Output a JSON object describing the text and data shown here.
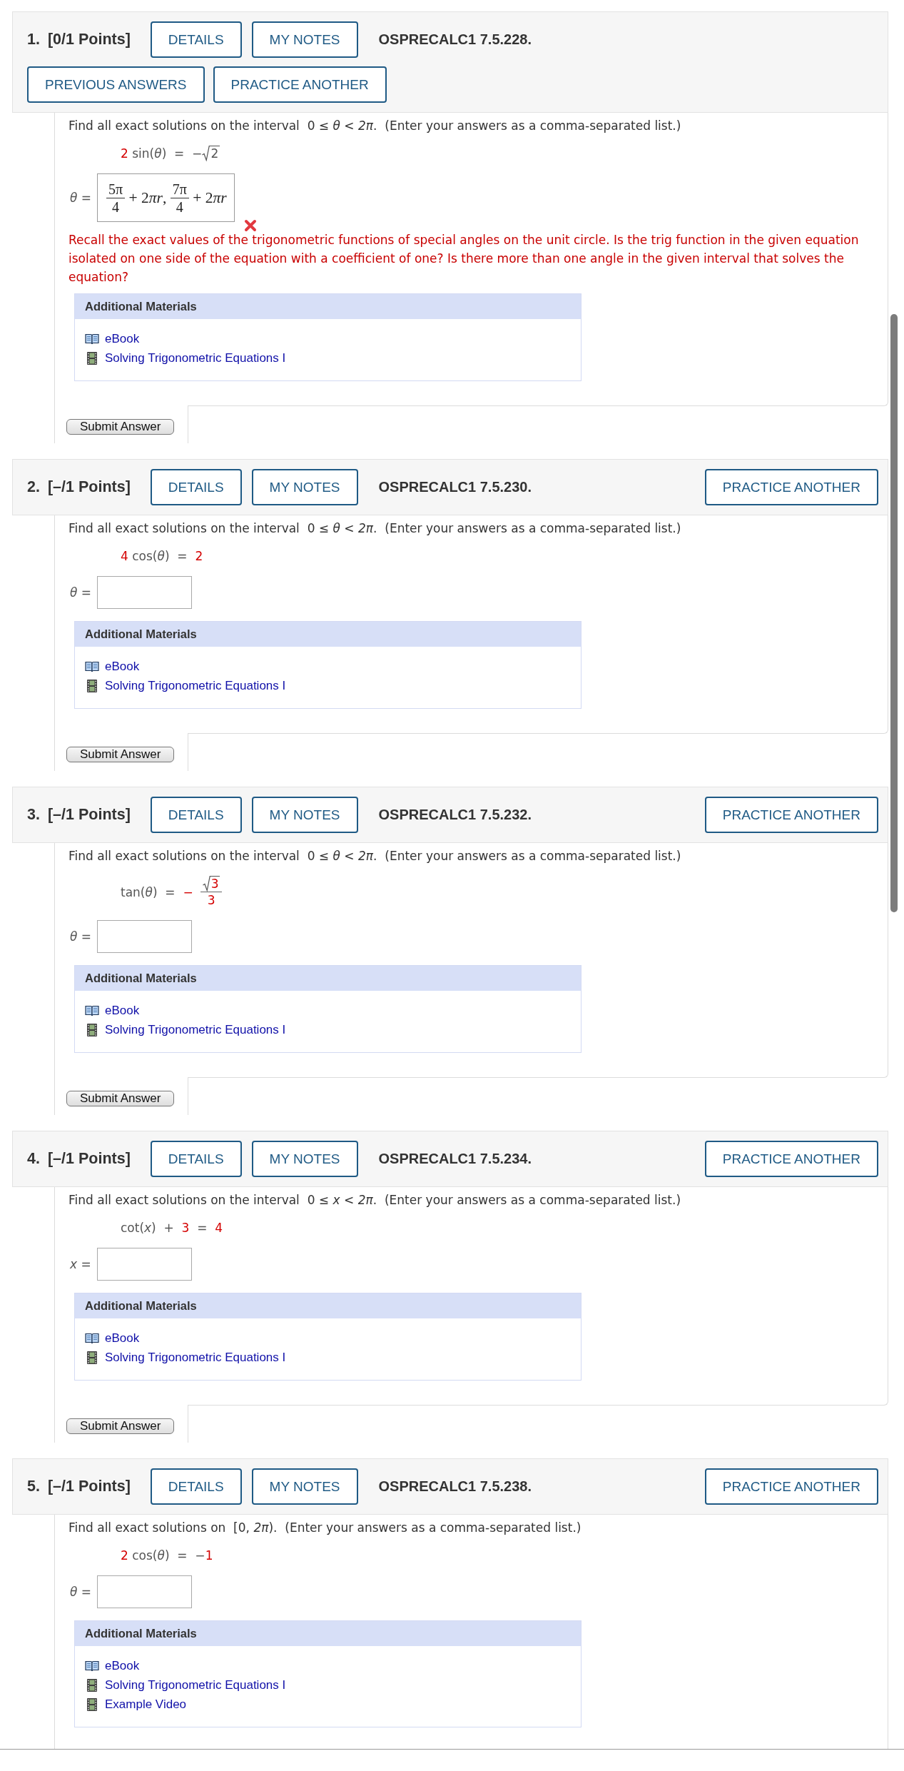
{
  "questions": [
    {
      "number": "1.",
      "points": "[0/1 Points]",
      "buttons": [
        "DETAILS",
        "MY NOTES"
      ],
      "code": "OSPRECALC1 7.5.228.",
      "actions": [
        "PREVIOUS ANSWERS",
        "PRACTICE ANOTHER"
      ],
      "prompt": "Find all exact solutions on the interval  0 ≤ *θ* < *2π*.  (Enter your answers as a comma-separated list.)",
      "equation": [
        {
          "kind": "text",
          "text": "2",
          "highlighted": true
        },
        {
          "kind": "text",
          "text": " sin(*θ*)  =  −",
          "highlighted": false
        },
        {
          "kind": "sqrt",
          "text": "2",
          "highlighted": false
        }
      ],
      "answer": {
        "label": "*θ* =",
        "value": [
          {
            "kind": "fraction",
            "numerator": "5π",
            "denominator": "4"
          },
          {
            "kind": "text",
            "text": " + 2"
          },
          {
            "kind": "text",
            "text": "*πr*, "
          },
          {
            "kind": "fraction",
            "numerator": "7π",
            "denominator": "4"
          },
          {
            "kind": "text",
            "text": " + 2"
          },
          {
            "kind": "text",
            "text": "*πr*"
          }
        ],
        "correct": false
      },
      "feedback": "Recall the exact values of the trigonometric functions of special angles on the unit circle. Is the trig function in the given equation isolated on one side of the equation with a coefficient of one? Is there more than one angle in the given interval that solves the equation?",
      "materials": {
        "title": "Additional Materials",
        "links": [
          {
            "kind": "ebook",
            "label": "eBook"
          },
          {
            "kind": "video",
            "label": "Solving Trigonometric Equations I"
          }
        ]
      },
      "submit": "Submit Answer"
    },
    {
      "number": "2.",
      "points": "[–/1 Points]",
      "buttons": [
        "DETAILS",
        "MY NOTES"
      ],
      "code": "OSPRECALC1 7.5.230.",
      "actions": [
        "PRACTICE ANOTHER"
      ],
      "prompt": "Find all exact solutions on the interval  0 ≤ *θ* < *2π*.  (Enter your answers as a comma-separated list.)",
      "equation": [
        {
          "kind": "text",
          "text": "4",
          "highlighted": true
        },
        {
          "kind": "text",
          "text": " cos(*θ*)  =  ",
          "highlighted": false
        },
        {
          "kind": "text",
          "text": "2",
          "highlighted": true
        }
      ],
      "answer": {
        "label": "*θ* ="
      },
      "materials": {
        "title": "Additional Materials",
        "links": [
          {
            "kind": "ebook",
            "label": "eBook"
          },
          {
            "kind": "video",
            "label": "Solving Trigonometric Equations I"
          }
        ]
      },
      "submit": "Submit Answer"
    },
    {
      "number": "3.",
      "points": "[–/1 Points]",
      "buttons": [
        "DETAILS",
        "MY NOTES"
      ],
      "code": "OSPRECALC1 7.5.232.",
      "actions": [
        "PRACTICE ANOTHER"
      ],
      "prompt": "Find all exact solutions on the interval  0 ≤ *θ* < *2π*.  (Enter your answers as a comma-separated list.)",
      "equation": [
        {
          "kind": "text",
          "text": "tan(*θ*)  =  ",
          "highlighted": false
        },
        {
          "kind": "text",
          "text": "−",
          "highlighted": true
        },
        {
          "kind": "fraction",
          "numerator": "3",
          "root": true,
          "denominator": "3",
          "highlighted": true
        }
      ],
      "answer": {
        "label": "*θ* ="
      },
      "materials": {
        "title": "Additional Materials",
        "links": [
          {
            "kind": "ebook",
            "label": "eBook"
          },
          {
            "kind": "video",
            "label": "Solving Trigonometric Equations I"
          }
        ]
      },
      "submit": "Submit Answer"
    },
    {
      "number": "4.",
      "points": "[–/1 Points]",
      "buttons": [
        "DETAILS",
        "MY NOTES"
      ],
      "code": "OSPRECALC1 7.5.234.",
      "actions": [
        "PRACTICE ANOTHER"
      ],
      "prompt": "Find all exact solutions on the interval  0 ≤ *x* < *2π*.  (Enter your answers as a comma-separated list.)",
      "equation": [
        {
          "kind": "text",
          "text": "cot(*x*)  +  ",
          "highlighted": false
        },
        {
          "kind": "text",
          "text": "3",
          "highlighted": true
        },
        {
          "kind": "text",
          "text": "  =  ",
          "highlighted": false
        },
        {
          "kind": "text",
          "text": "4",
          "highlighted": true
        }
      ],
      "answer": {
        "label": "*x* ="
      },
      "materials": {
        "title": "Additional Materials",
        "links": [
          {
            "kind": "ebook",
            "label": "eBook"
          },
          {
            "kind": "video",
            "label": "Solving Trigonometric Equations I"
          }
        ]
      },
      "submit": "Submit Answer"
    },
    {
      "number": "5.",
      "points": "[–/1 Points]",
      "buttons": [
        "DETAILS",
        "MY NOTES"
      ],
      "code": "OSPRECALC1 7.5.238.",
      "actions": [
        "PRACTICE ANOTHER"
      ],
      "prompt": "Find all exact solutions on  [0, *2π*).  (Enter your answers as a comma-separated list.)",
      "equation": [
        {
          "kind": "text",
          "text": "2",
          "highlighted": true
        },
        {
          "kind": "text",
          "text": " cos(*θ*)  =  −",
          "highlighted": false
        },
        {
          "kind": "text",
          "text": "1",
          "highlighted": true
        }
      ],
      "answer": {
        "label": "*θ* ="
      },
      "materials": {
        "title": "Additional Materials",
        "links": [
          {
            "kind": "ebook",
            "label": "eBook"
          },
          {
            "kind": "video",
            "label": "Solving Trigonometric Equations I"
          },
          {
            "kind": "video",
            "label": "Example Video"
          }
        ]
      }
    }
  ]
}
